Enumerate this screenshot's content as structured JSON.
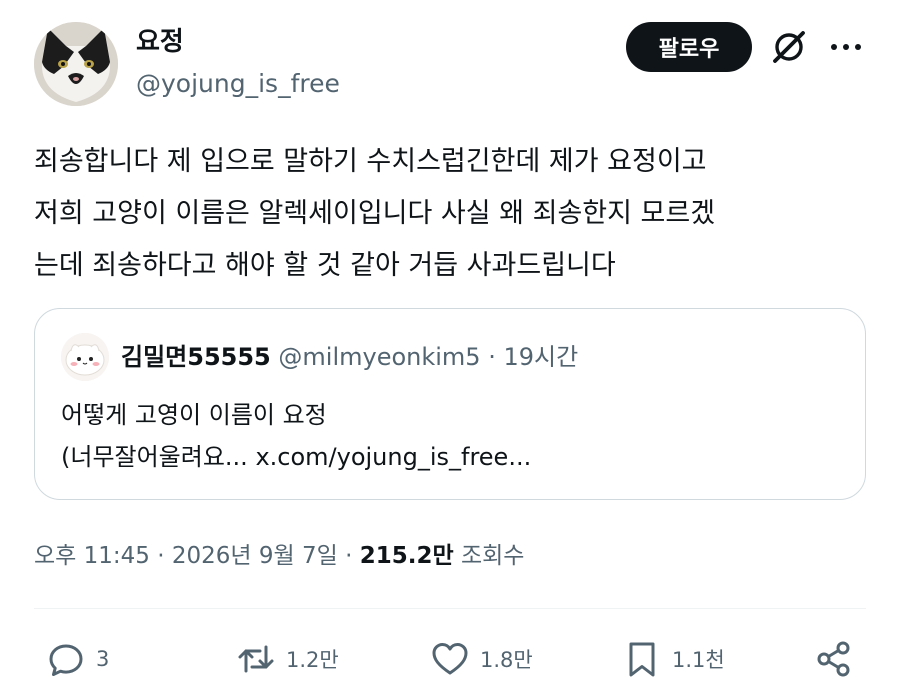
{
  "author": {
    "name": "요정",
    "handle": "@yojung_is_free",
    "avatar_icon": "cat-avatar"
  },
  "header": {
    "follow_label": "팔로우",
    "grok_icon": "grok-icon",
    "more_icon": "more-icon"
  },
  "tweet": {
    "line1": "죄송합니다 제 입으로 말하기 수치스럽긴한데 제가 요정이고",
    "line2": "저희 고양이 이름은 알렉세이입니다 사실 왜 죄송한지 모르겠",
    "line3": "는데 죄송하다고 해야 할 것 같아 거듭 사과드립니다"
  },
  "quote": {
    "name": "김밀면55555",
    "handle": "@milmyeonkim5",
    "separator": "·",
    "time": "19시간",
    "line1": "어떻게 고영이 이름이 요정",
    "line2": "(너무잘어울려요... x.com/yojung_is_free..."
  },
  "meta": {
    "time": "오후 11:45",
    "sep1": "·",
    "date": "2026년 9월 7일",
    "sep2": "·",
    "views": "215.2만",
    "views_label": "조회수"
  },
  "actions": {
    "reply_count": "3",
    "retweet_count": "1.2만",
    "like_count": "1.8만",
    "bookmark_count": "1.1천"
  },
  "colors": {
    "text": "#0f1419",
    "secondary": "#536471",
    "border": "#cfd9de",
    "button_bg": "#0f1419"
  }
}
